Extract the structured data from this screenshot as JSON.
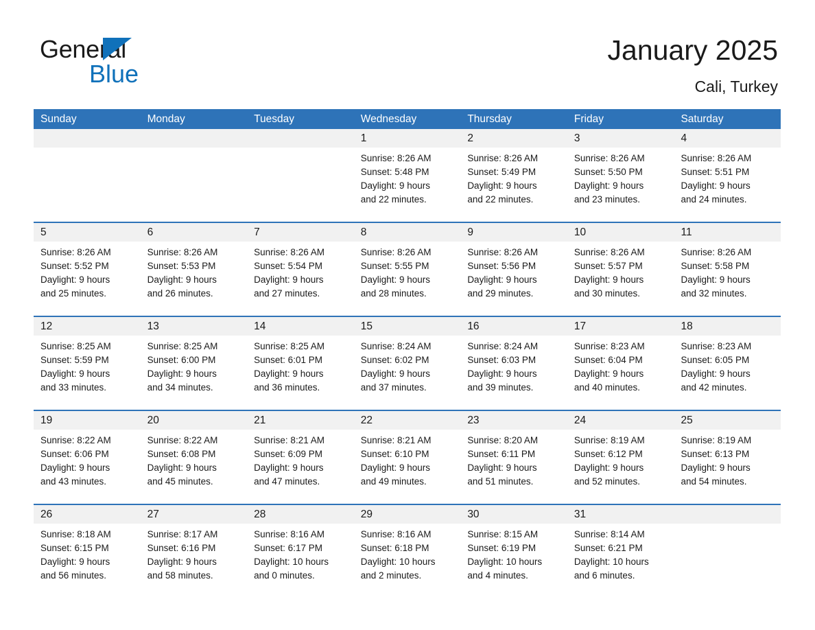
{
  "brand": {
    "word_top": "General",
    "word_bottom": "Blue",
    "triangle_color": "#1071BA",
    "accent_color": "#2E73B8"
  },
  "header": {
    "title": "January 2025",
    "subtitle": "Cali, Turkey"
  },
  "weekdays": [
    "Sunday",
    "Monday",
    "Tuesday",
    "Wednesday",
    "Thursday",
    "Friday",
    "Saturday"
  ],
  "weeks": [
    [
      {
        "empty": true,
        "day": "",
        "sunrise": "",
        "sunset": "",
        "daylight_1": "",
        "daylight_2": ""
      },
      {
        "empty": true,
        "day": "",
        "sunrise": "",
        "sunset": "",
        "daylight_1": "",
        "daylight_2": ""
      },
      {
        "empty": true,
        "day": "",
        "sunrise": "",
        "sunset": "",
        "daylight_1": "",
        "daylight_2": ""
      },
      {
        "empty": false,
        "day": "1",
        "sunrise": "Sunrise: 8:26 AM",
        "sunset": "Sunset: 5:48 PM",
        "daylight_1": "Daylight: 9 hours",
        "daylight_2": "and 22 minutes."
      },
      {
        "empty": false,
        "day": "2",
        "sunrise": "Sunrise: 8:26 AM",
        "sunset": "Sunset: 5:49 PM",
        "daylight_1": "Daylight: 9 hours",
        "daylight_2": "and 22 minutes."
      },
      {
        "empty": false,
        "day": "3",
        "sunrise": "Sunrise: 8:26 AM",
        "sunset": "Sunset: 5:50 PM",
        "daylight_1": "Daylight: 9 hours",
        "daylight_2": "and 23 minutes."
      },
      {
        "empty": false,
        "day": "4",
        "sunrise": "Sunrise: 8:26 AM",
        "sunset": "Sunset: 5:51 PM",
        "daylight_1": "Daylight: 9 hours",
        "daylight_2": "and 24 minutes."
      }
    ],
    [
      {
        "empty": false,
        "day": "5",
        "sunrise": "Sunrise: 8:26 AM",
        "sunset": "Sunset: 5:52 PM",
        "daylight_1": "Daylight: 9 hours",
        "daylight_2": "and 25 minutes."
      },
      {
        "empty": false,
        "day": "6",
        "sunrise": "Sunrise: 8:26 AM",
        "sunset": "Sunset: 5:53 PM",
        "daylight_1": "Daylight: 9 hours",
        "daylight_2": "and 26 minutes."
      },
      {
        "empty": false,
        "day": "7",
        "sunrise": "Sunrise: 8:26 AM",
        "sunset": "Sunset: 5:54 PM",
        "daylight_1": "Daylight: 9 hours",
        "daylight_2": "and 27 minutes."
      },
      {
        "empty": false,
        "day": "8",
        "sunrise": "Sunrise: 8:26 AM",
        "sunset": "Sunset: 5:55 PM",
        "daylight_1": "Daylight: 9 hours",
        "daylight_2": "and 28 minutes."
      },
      {
        "empty": false,
        "day": "9",
        "sunrise": "Sunrise: 8:26 AM",
        "sunset": "Sunset: 5:56 PM",
        "daylight_1": "Daylight: 9 hours",
        "daylight_2": "and 29 minutes."
      },
      {
        "empty": false,
        "day": "10",
        "sunrise": "Sunrise: 8:26 AM",
        "sunset": "Sunset: 5:57 PM",
        "daylight_1": "Daylight: 9 hours",
        "daylight_2": "and 30 minutes."
      },
      {
        "empty": false,
        "day": "11",
        "sunrise": "Sunrise: 8:26 AM",
        "sunset": "Sunset: 5:58 PM",
        "daylight_1": "Daylight: 9 hours",
        "daylight_2": "and 32 minutes."
      }
    ],
    [
      {
        "empty": false,
        "day": "12",
        "sunrise": "Sunrise: 8:25 AM",
        "sunset": "Sunset: 5:59 PM",
        "daylight_1": "Daylight: 9 hours",
        "daylight_2": "and 33 minutes."
      },
      {
        "empty": false,
        "day": "13",
        "sunrise": "Sunrise: 8:25 AM",
        "sunset": "Sunset: 6:00 PM",
        "daylight_1": "Daylight: 9 hours",
        "daylight_2": "and 34 minutes."
      },
      {
        "empty": false,
        "day": "14",
        "sunrise": "Sunrise: 8:25 AM",
        "sunset": "Sunset: 6:01 PM",
        "daylight_1": "Daylight: 9 hours",
        "daylight_2": "and 36 minutes."
      },
      {
        "empty": false,
        "day": "15",
        "sunrise": "Sunrise: 8:24 AM",
        "sunset": "Sunset: 6:02 PM",
        "daylight_1": "Daylight: 9 hours",
        "daylight_2": "and 37 minutes."
      },
      {
        "empty": false,
        "day": "16",
        "sunrise": "Sunrise: 8:24 AM",
        "sunset": "Sunset: 6:03 PM",
        "daylight_1": "Daylight: 9 hours",
        "daylight_2": "and 39 minutes."
      },
      {
        "empty": false,
        "day": "17",
        "sunrise": "Sunrise: 8:23 AM",
        "sunset": "Sunset: 6:04 PM",
        "daylight_1": "Daylight: 9 hours",
        "daylight_2": "and 40 minutes."
      },
      {
        "empty": false,
        "day": "18",
        "sunrise": "Sunrise: 8:23 AM",
        "sunset": "Sunset: 6:05 PM",
        "daylight_1": "Daylight: 9 hours",
        "daylight_2": "and 42 minutes."
      }
    ],
    [
      {
        "empty": false,
        "day": "19",
        "sunrise": "Sunrise: 8:22 AM",
        "sunset": "Sunset: 6:06 PM",
        "daylight_1": "Daylight: 9 hours",
        "daylight_2": "and 43 minutes."
      },
      {
        "empty": false,
        "day": "20",
        "sunrise": "Sunrise: 8:22 AM",
        "sunset": "Sunset: 6:08 PM",
        "daylight_1": "Daylight: 9 hours",
        "daylight_2": "and 45 minutes."
      },
      {
        "empty": false,
        "day": "21",
        "sunrise": "Sunrise: 8:21 AM",
        "sunset": "Sunset: 6:09 PM",
        "daylight_1": "Daylight: 9 hours",
        "daylight_2": "and 47 minutes."
      },
      {
        "empty": false,
        "day": "22",
        "sunrise": "Sunrise: 8:21 AM",
        "sunset": "Sunset: 6:10 PM",
        "daylight_1": "Daylight: 9 hours",
        "daylight_2": "and 49 minutes."
      },
      {
        "empty": false,
        "day": "23",
        "sunrise": "Sunrise: 8:20 AM",
        "sunset": "Sunset: 6:11 PM",
        "daylight_1": "Daylight: 9 hours",
        "daylight_2": "and 51 minutes."
      },
      {
        "empty": false,
        "day": "24",
        "sunrise": "Sunrise: 8:19 AM",
        "sunset": "Sunset: 6:12 PM",
        "daylight_1": "Daylight: 9 hours",
        "daylight_2": "and 52 minutes."
      },
      {
        "empty": false,
        "day": "25",
        "sunrise": "Sunrise: 8:19 AM",
        "sunset": "Sunset: 6:13 PM",
        "daylight_1": "Daylight: 9 hours",
        "daylight_2": "and 54 minutes."
      }
    ],
    [
      {
        "empty": false,
        "day": "26",
        "sunrise": "Sunrise: 8:18 AM",
        "sunset": "Sunset: 6:15 PM",
        "daylight_1": "Daylight: 9 hours",
        "daylight_2": "and 56 minutes."
      },
      {
        "empty": false,
        "day": "27",
        "sunrise": "Sunrise: 8:17 AM",
        "sunset": "Sunset: 6:16 PM",
        "daylight_1": "Daylight: 9 hours",
        "daylight_2": "and 58 minutes."
      },
      {
        "empty": false,
        "day": "28",
        "sunrise": "Sunrise: 8:16 AM",
        "sunset": "Sunset: 6:17 PM",
        "daylight_1": "Daylight: 10 hours",
        "daylight_2": "and 0 minutes."
      },
      {
        "empty": false,
        "day": "29",
        "sunrise": "Sunrise: 8:16 AM",
        "sunset": "Sunset: 6:18 PM",
        "daylight_1": "Daylight: 10 hours",
        "daylight_2": "and 2 minutes."
      },
      {
        "empty": false,
        "day": "30",
        "sunrise": "Sunrise: 8:15 AM",
        "sunset": "Sunset: 6:19 PM",
        "daylight_1": "Daylight: 10 hours",
        "daylight_2": "and 4 minutes."
      },
      {
        "empty": false,
        "day": "31",
        "sunrise": "Sunrise: 8:14 AM",
        "sunset": "Sunset: 6:21 PM",
        "daylight_1": "Daylight: 10 hours",
        "daylight_2": "and 6 minutes."
      },
      {
        "empty": true,
        "day": "",
        "sunrise": "",
        "sunset": "",
        "daylight_1": "",
        "daylight_2": ""
      }
    ]
  ]
}
